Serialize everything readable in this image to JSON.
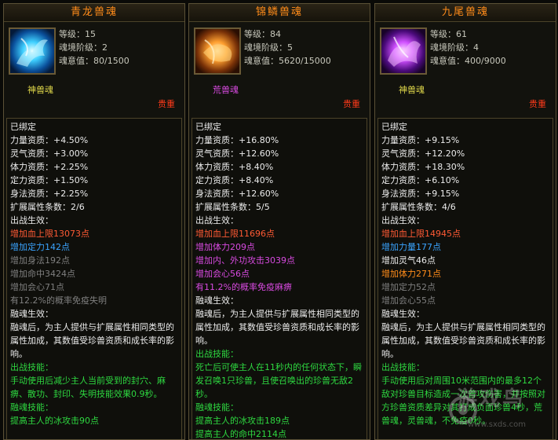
{
  "panels": [
    {
      "title": "青龙兽魂",
      "icon": "blue-dragon-soul-icon",
      "stats": [
        "等级：15",
        "魂境阶级：2",
        "魂意值：80/1500"
      ],
      "type_label": "神兽魂",
      "type_color": "#e0d84a",
      "rarity": "贵重",
      "bound": "已绑定",
      "aptitude": [
        "力量资质：+4.50%",
        "灵气资质：+3.00%",
        "体力资质：+2.25%",
        "定力资质：+1.50%",
        "身法资质：+2.25%"
      ],
      "ext_count": "扩展属性条数：2/6",
      "battle_effect_title": "出战生效：",
      "battle_effects": [
        {
          "text": "增加血上限13073点",
          "color": "#ff5a34"
        },
        {
          "text": "增加定力142点",
          "color": "#3aa4ff"
        },
        {
          "text": "增加身法192点",
          "color": "#7f7f7f"
        },
        {
          "text": "增加命中3424点",
          "color": "#7f7f7f"
        },
        {
          "text": "增加会心71点",
          "color": "#7f7f7f"
        },
        {
          "text": "有12.2%的概率免疫失明",
          "color": "#7f7f7f"
        }
      ],
      "merge_title": "融魂生效：",
      "merge_text": "融魂后，为主人提供与扩展属性相同类型的属性加成，其数值受珍兽资质和成长率的影响。",
      "battle_skill_title": "出战技能：",
      "battle_skill_text": "手动使用后减少主人当前受到的封穴、麻痹、散功、封印、失明技能效果0.9秒。",
      "merge_skill_title": "融魂技能：",
      "merge_skill_lines": [
        "提高主人的冰攻击90点"
      ]
    },
    {
      "title": "锦鳞兽魂",
      "icon": "golden-carp-soul-icon",
      "stats": [
        "等级：84",
        "魂境阶级：5",
        "魂意值：5620/15000"
      ],
      "type_label": "荒兽魂",
      "type_color": "#d84ae0",
      "rarity": "贵重",
      "bound": "已绑定",
      "aptitude": [
        "力量资质：+16.80%",
        "灵气资质：+12.60%",
        "体力资质：+8.40%",
        "定力资质：+8.40%",
        "身法资质：+12.60%"
      ],
      "ext_count": "扩展属性条数：5/5",
      "battle_effect_title": "出战生效：",
      "battle_effects": [
        {
          "text": "增加血上限11696点",
          "color": "#ff5a34"
        },
        {
          "text": "增加体力209点",
          "color": "#d84ae0"
        },
        {
          "text": "增加内、外功攻击3039点",
          "color": "#d84ae0"
        },
        {
          "text": "增加会心56点",
          "color": "#d84ae0"
        },
        {
          "text": "有11.2%的概率免疫麻痹",
          "color": "#d84ae0"
        }
      ],
      "merge_title": "融魂生效：",
      "merge_text": "融魂后，为主人提供与扩展属性相同类型的属性加成，其数值受珍兽资质和成长率的影响。",
      "battle_skill_title": "出战技能：",
      "battle_skill_text": "死亡后可使主人在11秒内的任何状态下，瞬发召唤1只珍兽，且使召唤出的珍兽无敌2秒。",
      "merge_skill_title": "融魂技能：",
      "merge_skill_lines": [
        "提高主人的冰攻击189点",
        "提高主人的命中2114点"
      ]
    },
    {
      "title": "九尾兽魂",
      "icon": "nine-tail-fox-soul-icon",
      "stats": [
        "等级：61",
        "魂境阶级：4",
        "魂意值：400/9000"
      ],
      "type_label": "神兽魂",
      "type_color": "#e0d84a",
      "rarity": "贵重",
      "bound": "已绑定",
      "aptitude": [
        "力量资质：+9.15%",
        "灵气资质：+12.20%",
        "体力资质：+18.30%",
        "定力资质：+6.10%",
        "身法资质：+9.15%"
      ],
      "ext_count": "扩展属性条数：4/6",
      "battle_effect_title": "出战生效：",
      "battle_effects": [
        {
          "text": "增加血上限14945点",
          "color": "#ff5a34"
        },
        {
          "text": "增加力量177点",
          "color": "#3aa4ff"
        },
        {
          "text": "增加灵气46点",
          "color": "#ececec"
        },
        {
          "text": "增加体力271点",
          "color": "#ff8c1a"
        },
        {
          "text": "增加定力52点",
          "color": "#7f7f7f"
        },
        {
          "text": "增加会心55点",
          "color": "#7f7f7f"
        }
      ],
      "merge_title": "融魂生效：",
      "merge_text": "融魂后，为主人提供与扩展属性相同类型的属性加成，其数值受珍兽资质和成长率的影响。",
      "battle_skill_title": "出战技能：",
      "battle_skill_text": "手动使用后对周围10米范围内的最多12个敌对珍兽目标造成一次普攻伤害，并按照对方珍兽资质差异对其打成负面珍兽4秒，荒兽魂，灵兽魂，不免疫0秒。",
      "merge_skill_title": "",
      "merge_skill_lines": []
    }
  ],
  "watermark": {
    "text": "游戏鸟",
    "url": "www.sxds.com"
  }
}
